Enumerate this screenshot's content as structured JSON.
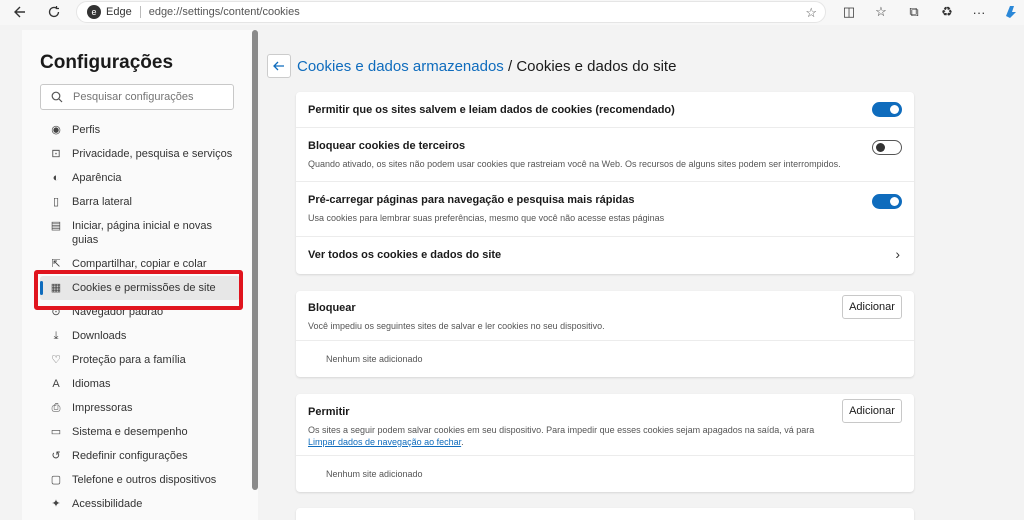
{
  "browser": {
    "edge_label": "Edge",
    "url": "edge://settings/content/cookies"
  },
  "sidebar": {
    "title": "Configurações",
    "search_placeholder": "Pesquisar configurações",
    "items": [
      {
        "label": "Perfis",
        "icon": "profile-icon"
      },
      {
        "label": "Privacidade, pesquisa e serviços",
        "icon": "lock-icon"
      },
      {
        "label": "Aparência",
        "icon": "appearance-icon"
      },
      {
        "label": "Barra lateral",
        "icon": "sidebar-icon"
      },
      {
        "label": "Iniciar, página inicial e novas guias",
        "icon": "home-icon"
      },
      {
        "label": "Compartilhar, copiar e colar",
        "icon": "share-icon"
      },
      {
        "label": "Cookies e permissões de site",
        "icon": "cookies-icon"
      },
      {
        "label": "Navegador padrão",
        "icon": "browser-icon"
      },
      {
        "label": "Downloads",
        "icon": "download-icon"
      },
      {
        "label": "Proteção para a família",
        "icon": "family-icon"
      },
      {
        "label": "Idiomas",
        "icon": "language-icon"
      },
      {
        "label": "Impressoras",
        "icon": "printer-icon"
      },
      {
        "label": "Sistema e desempenho",
        "icon": "system-icon"
      },
      {
        "label": "Redefinir configurações",
        "icon": "reset-icon"
      },
      {
        "label": "Telefone e outros dispositivos",
        "icon": "phone-icon"
      },
      {
        "label": "Acessibilidade",
        "icon": "accessibility-icon"
      }
    ]
  },
  "main": {
    "breadcrumb_link": "Cookies e dados armazenados",
    "breadcrumb_sep": " / ",
    "breadcrumb_current": "Cookies e dados do site",
    "settings": {
      "allow_cookies": {
        "title": "Permitir que os sites salvem e leiam dados de cookies (recomendado)",
        "state": "on"
      },
      "block_third_party": {
        "title": "Bloquear cookies de terceiros",
        "desc": "Quando ativado, os sites não podem usar cookies que rastreiam você na Web. Os recursos de alguns sites podem ser interrompidos.",
        "state": "off"
      },
      "preload": {
        "title": "Pré-carregar páginas para navegação e pesquisa mais rápidas",
        "desc": "Usa cookies para lembrar suas preferências, mesmo que você não acesse estas páginas",
        "state": "on"
      },
      "see_all": {
        "title": "Ver todos os cookies e dados do site"
      }
    },
    "block": {
      "title": "Bloquear",
      "desc": "Você impediu os seguintes sites de salvar e ler cookies no seu dispositivo.",
      "add_label": "Adicionar",
      "empty": "Nenhum site adicionado"
    },
    "allow": {
      "title": "Permitir",
      "desc_prefix": "Os sites a seguir podem salvar cookies em seu dispositivo. Para impedir que esses cookies sejam apagados na saída, vá para ",
      "desc_link": "Limpar dados de navegação ao fechar",
      "desc_suffix": ".",
      "add_label": "Adicionar",
      "empty": "Nenhum site adicionado"
    }
  },
  "colors": {
    "accent": "#0f6cbd",
    "highlight": "#e0141e"
  }
}
